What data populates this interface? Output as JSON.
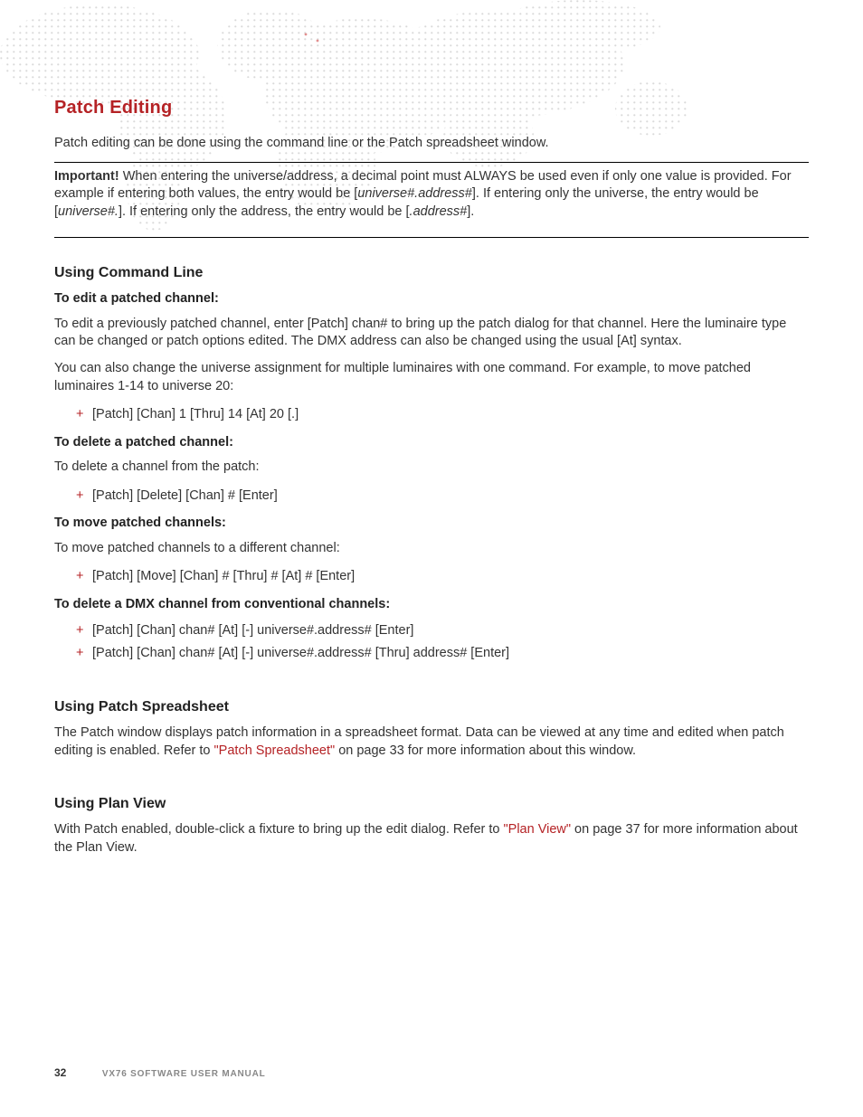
{
  "title": "Patch Editing",
  "intro": "Patch editing can be done using the command line or the Patch spreadsheet window.",
  "important": {
    "label": "Important!",
    "t1": "  When entering the universe/address, a decimal point must ALWAYS be used even if only one value is provided. For example if entering both values, the entry would be [",
    "i1": "universe#.address#",
    "t2": "]. If entering only the universe, the entry would be [",
    "i2": "universe#.",
    "t3": "]. If entering only the address, the entry would be [",
    "i3": ".address#",
    "t4": "]."
  },
  "cmd": {
    "heading": "Using Command Line",
    "edit": {
      "title": "To edit a patched channel:",
      "p1": "To edit a previously patched channel, enter [Patch] chan# to bring up the patch dialog for that channel. Here the luminaire type can be changed or patch options edited. The DMX address can also be changed using the usual [At] syntax.",
      "p2": "You can also change the universe assignment for multiple luminaires with one command. For example, to move patched luminaires 1-14 to universe 20:",
      "li1": "[Patch] [Chan] 1 [Thru] 14 [At] 20 [.]"
    },
    "del": {
      "title": "To delete a patched channel:",
      "p1": "To delete a channel from the patch:",
      "li1": "[Patch] [Delete] [Chan] # [Enter]"
    },
    "move": {
      "title": "To move patched channels:",
      "p1": "To move patched channels to a different channel:",
      "li1": "[Patch] [Move] [Chan] # [Thru] # [At] # [Enter]"
    },
    "dmx": {
      "title": "To delete a DMX channel from conventional channels:",
      "li1": "[Patch] [Chan] chan# [At] [-] universe#.address# [Enter]",
      "li2": "[Patch] [Chan] chan# [At] [-] universe#.address# [Thru] address# [Enter]"
    }
  },
  "spread": {
    "heading": "Using Patch Spreadsheet",
    "t1": "The Patch window displays patch information in a spreadsheet format. Data can be viewed at any time and edited when patch editing is enabled. Refer to ",
    "link": "\"Patch Spreadsheet\"",
    "t2": " on page 33 for more information about this window."
  },
  "plan": {
    "heading": "Using Plan View",
    "t1": "With Patch enabled, double-click a fixture to bring up the edit dialog. Refer to ",
    "link": "\"Plan View\"",
    "t2": " on page 37 for more information about the Plan View."
  },
  "footer": {
    "page": "32",
    "manual": "VX76 SOFTWARE USER MANUAL"
  }
}
